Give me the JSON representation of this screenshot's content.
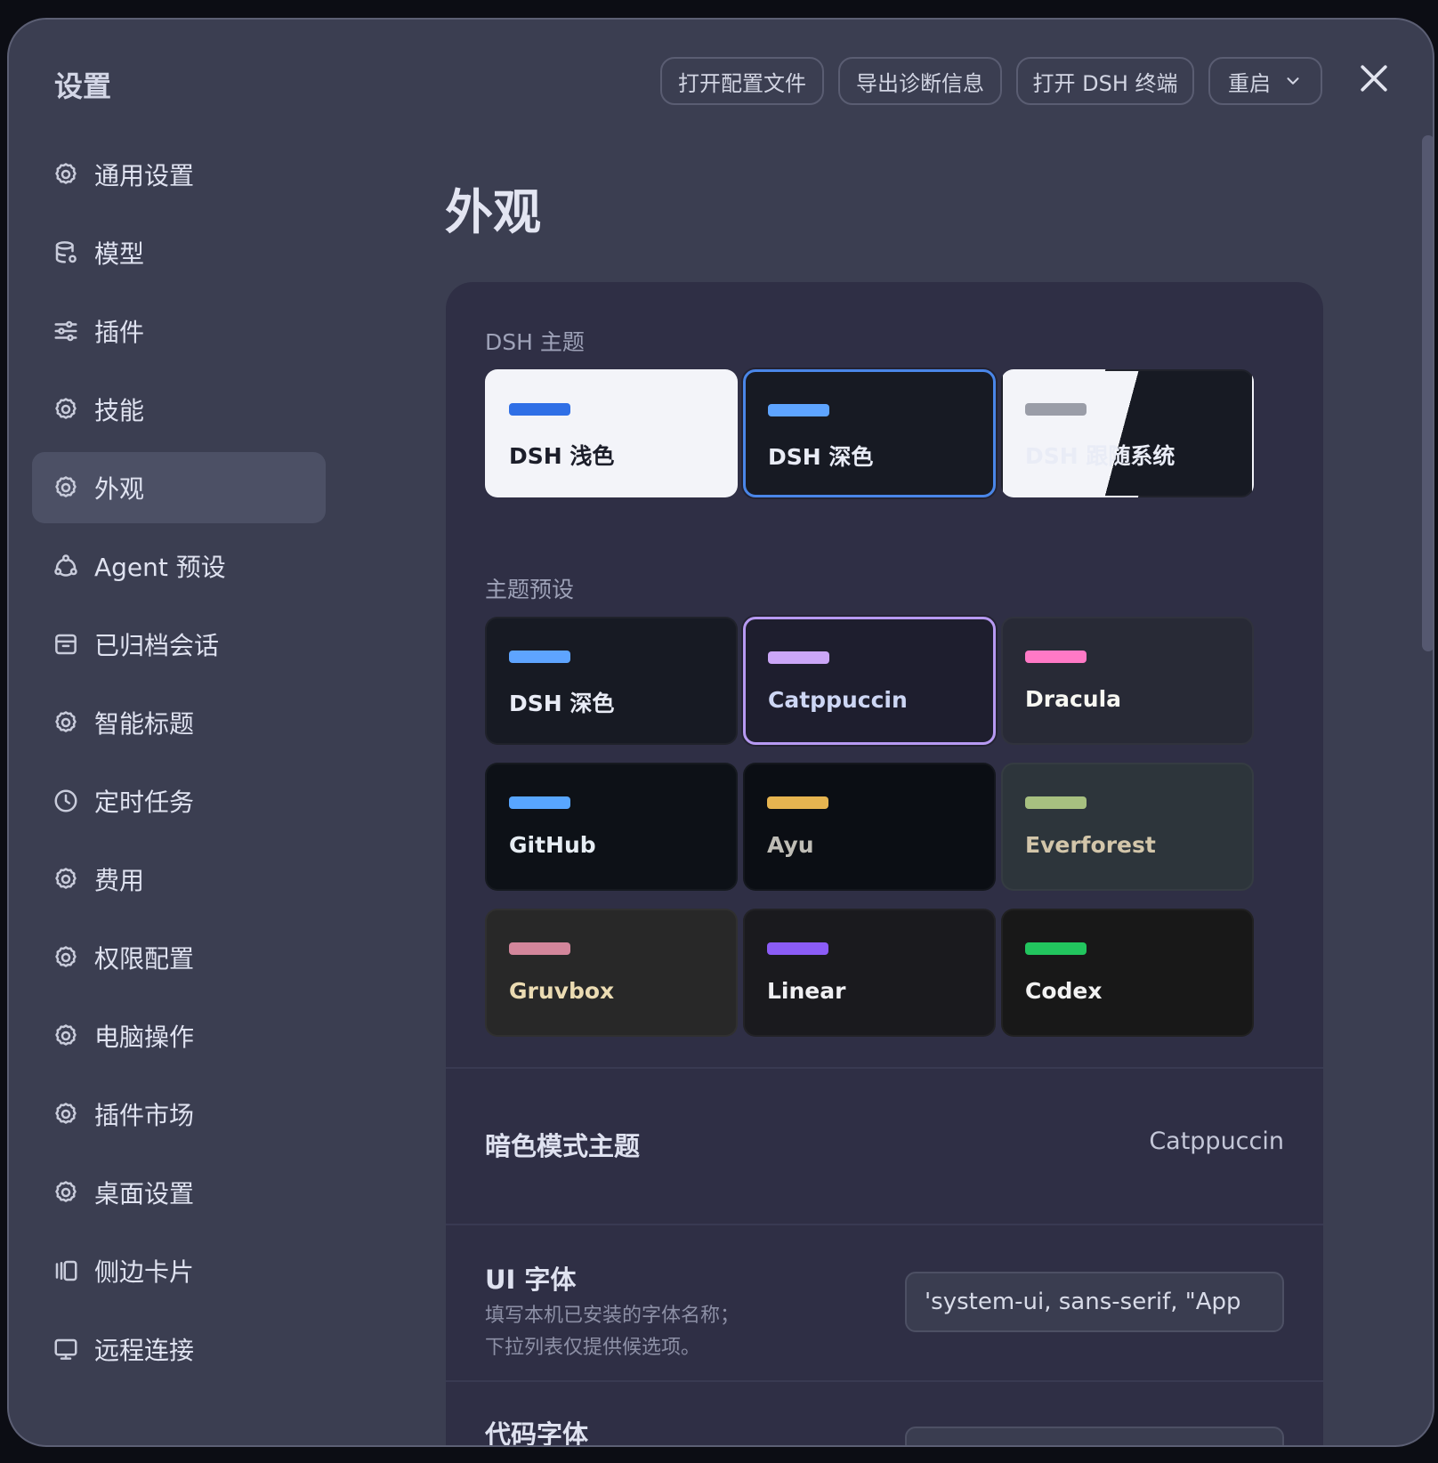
{
  "window": {
    "title": "设置"
  },
  "toolbar": {
    "buttons": [
      "打开配置文件",
      "导出诊断信息",
      "打开 DSH 终端",
      "重启"
    ]
  },
  "sidebar": {
    "items": [
      {
        "label": "通用设置",
        "icon": "gear-icon"
      },
      {
        "label": "模型",
        "icon": "database-icon"
      },
      {
        "label": "插件",
        "icon": "sliders-icon"
      },
      {
        "label": "技能",
        "icon": "gear-icon"
      },
      {
        "label": "外观",
        "icon": "gear-icon",
        "active": true
      },
      {
        "label": "Agent 预设",
        "icon": "agent-icon"
      },
      {
        "label": "已归档会话",
        "icon": "archive-icon"
      },
      {
        "label": "智能标题",
        "icon": "gear-icon"
      },
      {
        "label": "定时任务",
        "icon": "clock-icon"
      },
      {
        "label": "费用",
        "icon": "gear-icon"
      },
      {
        "label": "权限配置",
        "icon": "gear-icon"
      },
      {
        "label": "电脑操作",
        "icon": "gear-icon"
      },
      {
        "label": "插件市场",
        "icon": "gear-icon"
      },
      {
        "label": "桌面设置",
        "icon": "gear-icon"
      },
      {
        "label": "侧边卡片",
        "icon": "side-cards-icon"
      },
      {
        "label": "远程连接",
        "icon": "monitor-icon"
      }
    ]
  },
  "main": {
    "title": "外观",
    "dsh_theme_label": "DSH 主题",
    "dsh_themes": [
      {
        "label": "DSH 浅色",
        "swatch": "#2f6fe6",
        "bg": "#f3f4f9",
        "fg": "#1c1e2a"
      },
      {
        "label": "DSH 深色",
        "swatch": "#5ea4ff",
        "bg": "#171a23",
        "fg": "#e9ecf6",
        "selected": true
      },
      {
        "label": "DSH 跟随系统",
        "swatch": "#9a9da8",
        "bg": "split",
        "fg": "#e9ecf6"
      }
    ],
    "preset_label": "主题预设",
    "presets": [
      {
        "label": "DSH 深色",
        "swatch": "#5ea4ff",
        "bg": "#171a23",
        "fg": "#e9ecf6"
      },
      {
        "label": "Catppuccin",
        "swatch": "#cba6f7",
        "bg": "#1e1e2e",
        "fg": "#cdd6f4",
        "selected": true
      },
      {
        "label": "Dracula",
        "swatch": "#ff79c6",
        "bg": "#282a36",
        "fg": "#f8f8f2"
      },
      {
        "label": "GitHub",
        "swatch": "#58a6ff",
        "bg": "#0d1117",
        "fg": "#e6edf3"
      },
      {
        "label": "Ayu",
        "swatch": "#e6b450",
        "bg": "#0b0e14",
        "fg": "#bfbdb6"
      },
      {
        "label": "Everforest",
        "swatch": "#a7c080",
        "bg": "#2d353b",
        "fg": "#d3c6aa"
      },
      {
        "label": "Gruvbox",
        "swatch": "#d3869b",
        "bg": "#282828",
        "fg": "#ebdbb2"
      },
      {
        "label": "Linear",
        "swatch": "#8b5cf6",
        "bg": "#1a1a1e",
        "fg": "#f0f0f3"
      },
      {
        "label": "Codex",
        "swatch": "#22c55e",
        "bg": "#181818",
        "fg": "#f2f2f2"
      }
    ],
    "dark_mode_theme": {
      "label": "暗色模式主题",
      "value": "Catppuccin"
    },
    "ui_font": {
      "label": "UI 字体",
      "description_line1": "填写本机已安装的字体名称；",
      "description_line2": "下拉列表仅提供候选项。",
      "value": "'system-ui, sans-serif, \"App"
    },
    "code_font": {
      "label": "代码字体"
    }
  },
  "colors": {
    "accent_selected_blue": "#4a86e8",
    "accent_selected_purple": "#b79af2"
  }
}
